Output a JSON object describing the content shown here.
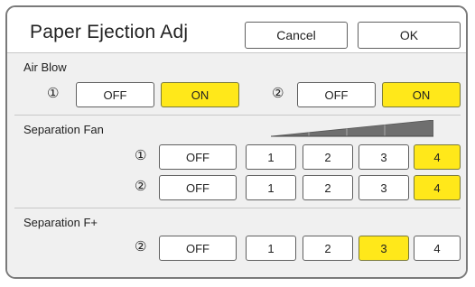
{
  "header": {
    "title": "Paper Ejection Adj",
    "cancel_label": "Cancel",
    "ok_label": "OK"
  },
  "air_blow": {
    "label": "Air Blow",
    "group1": {
      "marker": "①",
      "off_label": "OFF",
      "on_label": "ON",
      "selected": "ON"
    },
    "group2": {
      "marker": "②",
      "off_label": "OFF",
      "on_label": "ON",
      "selected": "ON"
    }
  },
  "separation_fan": {
    "label": "Separation Fan",
    "row1": {
      "marker": "①",
      "options": [
        "OFF",
        "1",
        "2",
        "3",
        "4"
      ],
      "selected": "4"
    },
    "row2": {
      "marker": "②",
      "options": [
        "OFF",
        "1",
        "2",
        "3",
        "4"
      ],
      "selected": "4"
    }
  },
  "separation_f_plus": {
    "label": "Separation F+",
    "row": {
      "marker": "②",
      "options": [
        "OFF",
        "1",
        "2",
        "3",
        "4"
      ],
      "selected": "3"
    }
  },
  "colors": {
    "selected": "#ffe81a",
    "panel": "#f0f0f0",
    "border": "#606060"
  }
}
